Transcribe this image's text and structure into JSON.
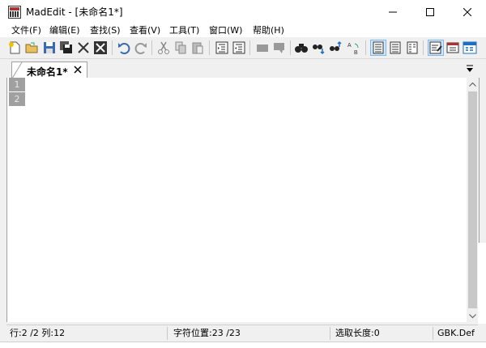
{
  "window": {
    "title": "MadEdit - [未命名1*]"
  },
  "menu": {
    "items": [
      {
        "id": "file",
        "label": "文件(F)"
      },
      {
        "id": "edit",
        "label": "编辑(E)"
      },
      {
        "id": "search",
        "label": "查找(S)"
      },
      {
        "id": "view",
        "label": "查看(V)"
      },
      {
        "id": "tools",
        "label": "工具(T)"
      },
      {
        "id": "window",
        "label": "窗口(W)"
      },
      {
        "id": "help",
        "label": "帮助(H)"
      }
    ]
  },
  "tabs": [
    {
      "label": "未命名1*",
      "active": true
    }
  ],
  "editor": {
    "line_numbers": [
      "1",
      "2"
    ]
  },
  "status": {
    "position": "行:2 /2 列:12",
    "char_pos": "字符位置:23 /23",
    "selection": "选取长度:0",
    "encoding": "GBK.Default"
  },
  "colors": {
    "accent": "#1e6fc2",
    "gutter": "#a0a0a0",
    "toolbar_active": "#cde8ff"
  }
}
